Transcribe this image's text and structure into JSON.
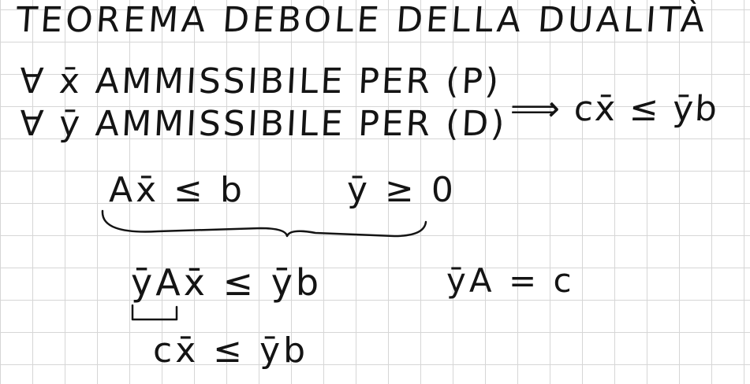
{
  "page": {
    "title": "TEOREMA DEBOLE DELLA DUALITÀ",
    "hypothesis_primal": "∀ x̄ AMMISSIBILE PER (P)",
    "hypothesis_dual": "∀ ȳ AMMISSIBILE PER (D)",
    "conclusion": "⟹ cx̄ ≤ ȳb",
    "primal_constraint": "Ax̄ ≤ b",
    "dual_constraint": "ȳ ≥ 0",
    "step_multiply": "ȳAx̄ ≤ ȳb",
    "dual_equality": "ȳA = c",
    "step_result": "cx̄ ≤ ȳb"
  },
  "colors": {
    "ink": "#141414",
    "grid": "#d6d6d6",
    "paper": "#ffffff"
  }
}
